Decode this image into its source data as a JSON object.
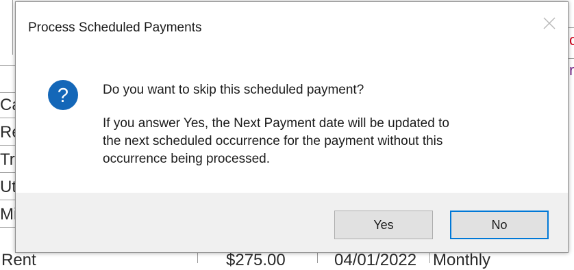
{
  "background_app": {
    "row_labels": [
      "Ca",
      "Re",
      "Tr",
      "Ut",
      "Mi"
    ],
    "bottom_row": {
      "label": "Rent",
      "amount": "$275.00",
      "date": "04/01/2022",
      "frequency": "Monthly"
    },
    "right_edge_glyphs": [
      "c",
      "r"
    ]
  },
  "dialog": {
    "title": "Process Scheduled Payments",
    "icon": "question-icon",
    "close_icon": "close-icon",
    "message_primary": "Do you want to skip this scheduled payment?",
    "message_secondary_lines": [
      "If you answer Yes, the Next Payment date will be updated to",
      "the next scheduled occurrence for the payment without this",
      "occurrence being processed."
    ],
    "buttons": {
      "yes_label": "Yes",
      "no_label": "No"
    },
    "colors": {
      "icon_blue": "#1467b8",
      "default_button_border": "#0078d7",
      "footer_bg": "#f0f0f0"
    }
  }
}
